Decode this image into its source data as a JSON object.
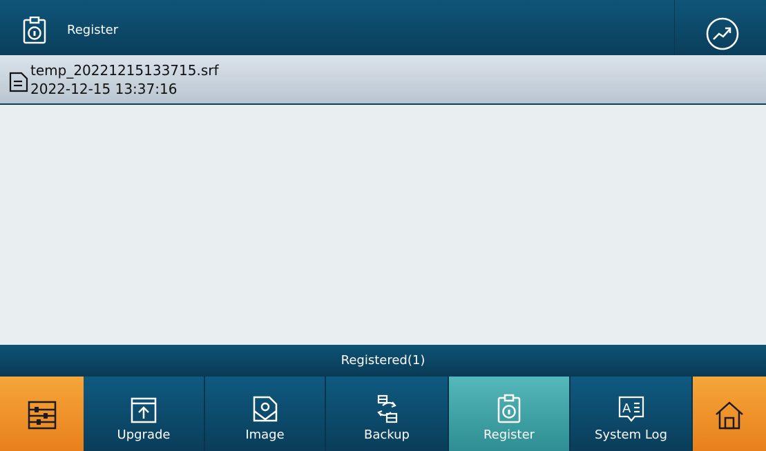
{
  "header": {
    "title": "Register",
    "title_icon": "clipboard-lock-icon",
    "right_icon": "trend-chart-icon"
  },
  "files": [
    {
      "name": "temp_20221215133715.srf",
      "date": "2022-12-15 13:37:16",
      "icon": "file-icon"
    }
  ],
  "status": {
    "text": "Registered(1)"
  },
  "nav": {
    "items": [
      {
        "id": "settings",
        "label": "",
        "icon": "settings-sliders-icon"
      },
      {
        "id": "upgrade",
        "label": "Upgrade",
        "icon": "upgrade-icon"
      },
      {
        "id": "image",
        "label": "Image",
        "icon": "image-icon"
      },
      {
        "id": "backup",
        "label": "Backup",
        "icon": "backup-icon"
      },
      {
        "id": "register",
        "label": "Register",
        "icon": "register-icon",
        "active": true
      },
      {
        "id": "system-log",
        "label": "System Log",
        "icon": "system-log-icon"
      },
      {
        "id": "home",
        "label": "",
        "icon": "home-icon"
      }
    ]
  },
  "colors": {
    "header_bg": "#0c4a6b",
    "active_tab": "#3ea3a7",
    "orange": "#f0922a",
    "row_bg": "#c8d3dd"
  }
}
